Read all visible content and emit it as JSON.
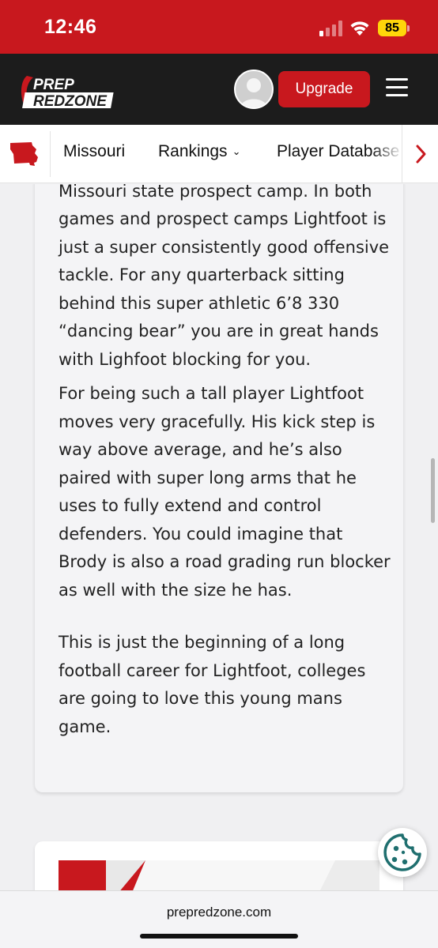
{
  "status_bar": {
    "time": "12:46",
    "battery": "85"
  },
  "header": {
    "logo_line1": "PREP",
    "logo_line2": "REDZONE",
    "upgrade_label": "Upgrade"
  },
  "nav": {
    "items": [
      "Missouri",
      "Rankings",
      "Player Database"
    ],
    "state_icon": "missouri-state-icon"
  },
  "article": {
    "paragraphs": [
      "year for the Willard tigers and at the Missouri state prospect camp. In both games and prospect camps Lightfoot is just a super consistently good offensive tackle. For any quarterback sitting behind this super athletic 6’8 330 “dancing bear” you are in great hands with Lighfoot blocking for you.",
      "For being such a tall player Lightfoot moves very gracefully. His kick step is way above average, and he’s also paired with super long arms that he uses to fully extend and control defenders. You could imagine that Brody is also a road grading run blocker as well with the size he has.",
      "This is just the beginning of a long football career for Lightfoot, colleges are going to love this young mans game."
    ]
  },
  "browser": {
    "url": "prepredzone.com"
  },
  "colors": {
    "brand_red": "#c8181e",
    "header_bg": "#1c1c1c",
    "battery": "#ffd60a",
    "cookie_teal": "#1f6f6f"
  }
}
